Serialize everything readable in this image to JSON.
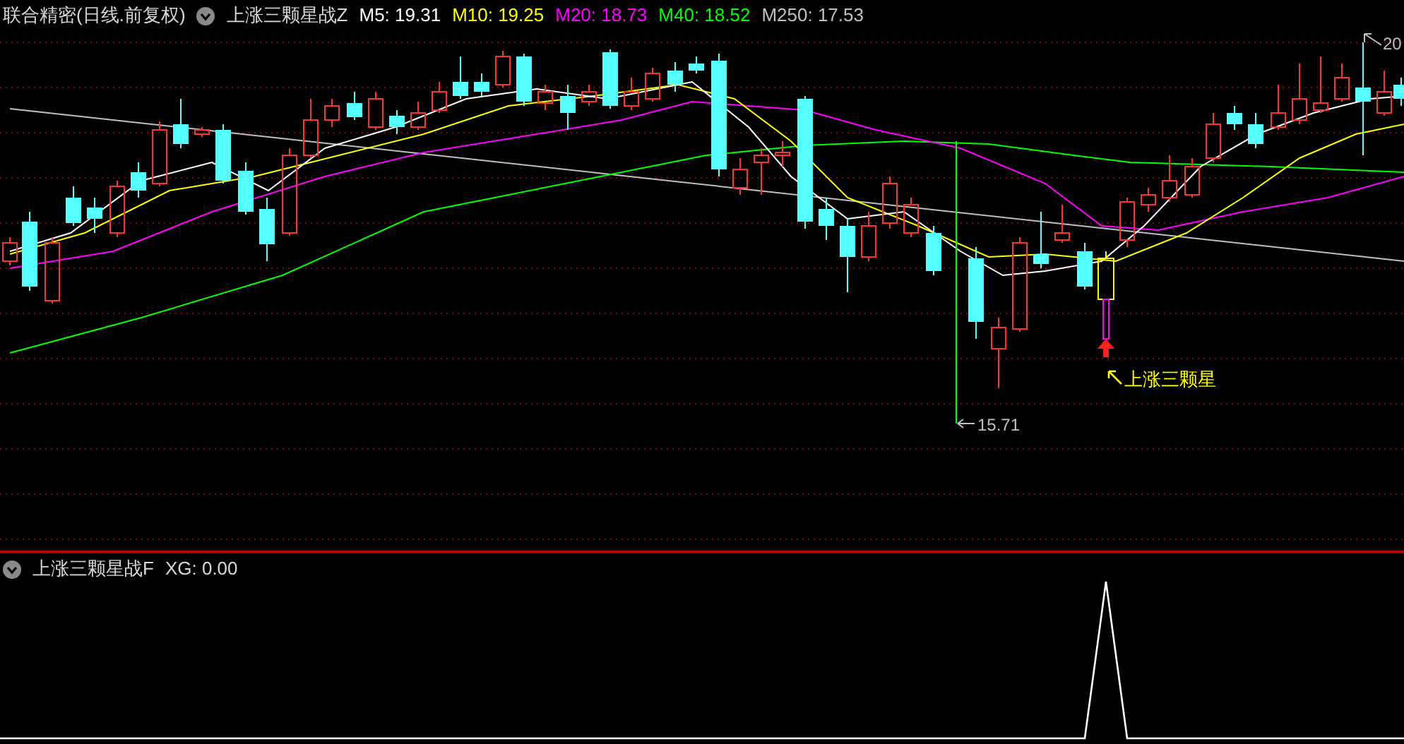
{
  "main_panel": {
    "title": "联合精密(日线.前复权)",
    "indicator": "上涨三颗星战Z",
    "averages": [
      {
        "label": "M5: 19.31",
        "color": "#ffffff"
      },
      {
        "label": "M10: 19.25",
        "color": "#ffff00"
      },
      {
        "label": "M20: 18.73",
        "color": "#ff00ff"
      },
      {
        "label": "M40: 18.52",
        "color": "#00ff00"
      },
      {
        "label": "M250: 17.53",
        "color": "#c0c0c0"
      }
    ],
    "high_label": "20",
    "low_label": "15.71",
    "signal_label": "上涨三颗星"
  },
  "sub_panel": {
    "title": "上涨三颗星战F",
    "reading": "XG: 0.00"
  }
}
